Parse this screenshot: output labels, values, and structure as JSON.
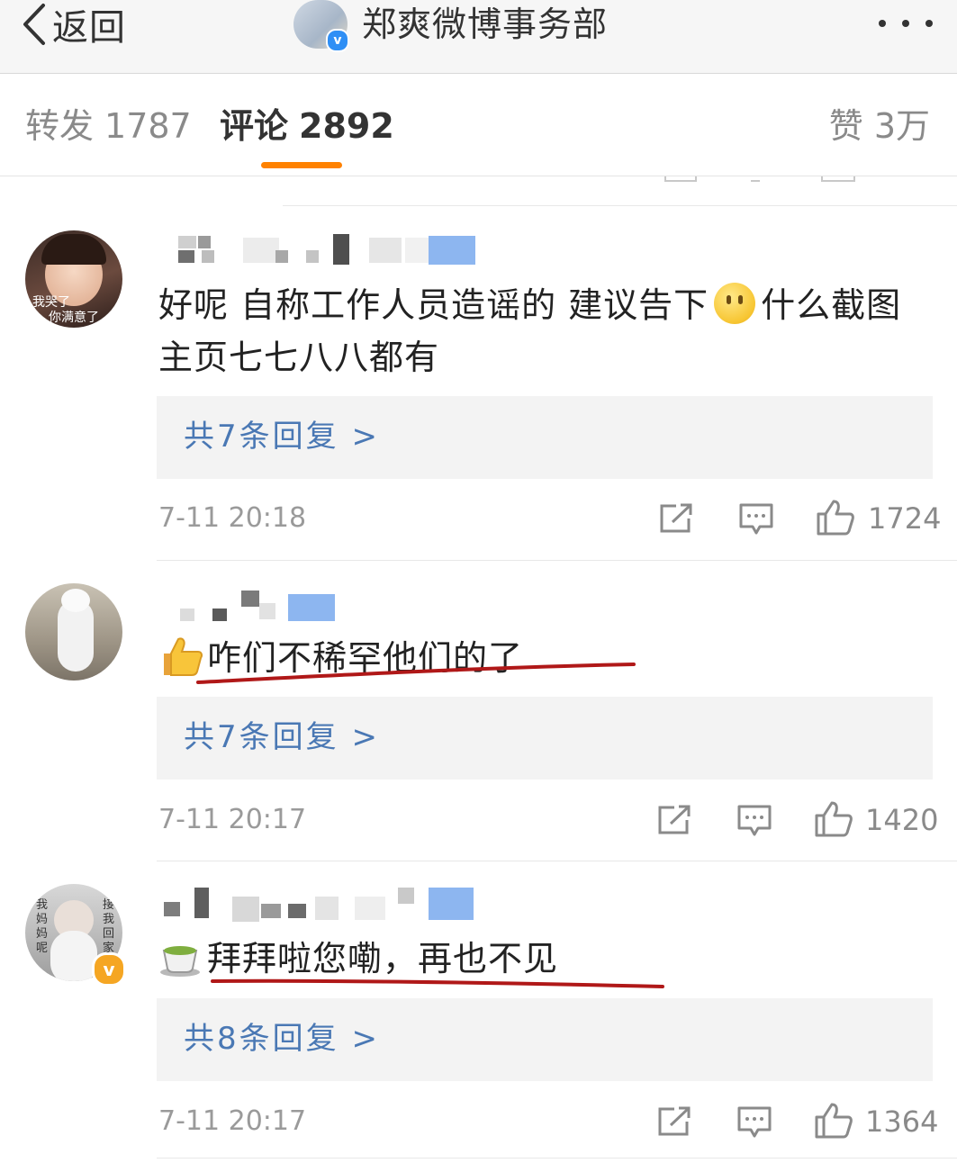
{
  "navbar": {
    "back_label": "返回",
    "title": "郑爽微博事务部",
    "verified_mark": "v"
  },
  "tabs": {
    "repost_label": "转发",
    "repost_count": "1787",
    "comment_label": "评论",
    "comment_count": "2892",
    "like_label": "赞",
    "like_count": "3万",
    "active": "comment",
    "accent_color": "#ff8200"
  },
  "comments": [
    {
      "avatar_text_1": "我哭了",
      "avatar_text_2": "你满意了",
      "text": "好呢 自称工作人员造谣的 建议告下",
      "emoji": "smile",
      "text_after_emoji": "什么截图",
      "text_line2": "主页七七八八都有",
      "replies": "共7条回复 >",
      "time": "7-11 20:18",
      "likes": "1724"
    },
    {
      "emoji": "thumbs-up",
      "text": "咋们不稀罕他们的了",
      "replies": "共7条回复 >",
      "time": "7-11 20:17",
      "likes": "1420"
    },
    {
      "avatar_text_1": "我妈妈呢",
      "avatar_text_2": "接我回家",
      "verified_mark": "v",
      "emoji": "tea",
      "text": "拜拜啦您嘞，再也不见",
      "replies": "共8条回复 >",
      "time": "7-11 20:17",
      "likes": "1364"
    }
  ],
  "colors": {
    "link": "#4a78b4",
    "annotation_underline": "#b01818"
  }
}
